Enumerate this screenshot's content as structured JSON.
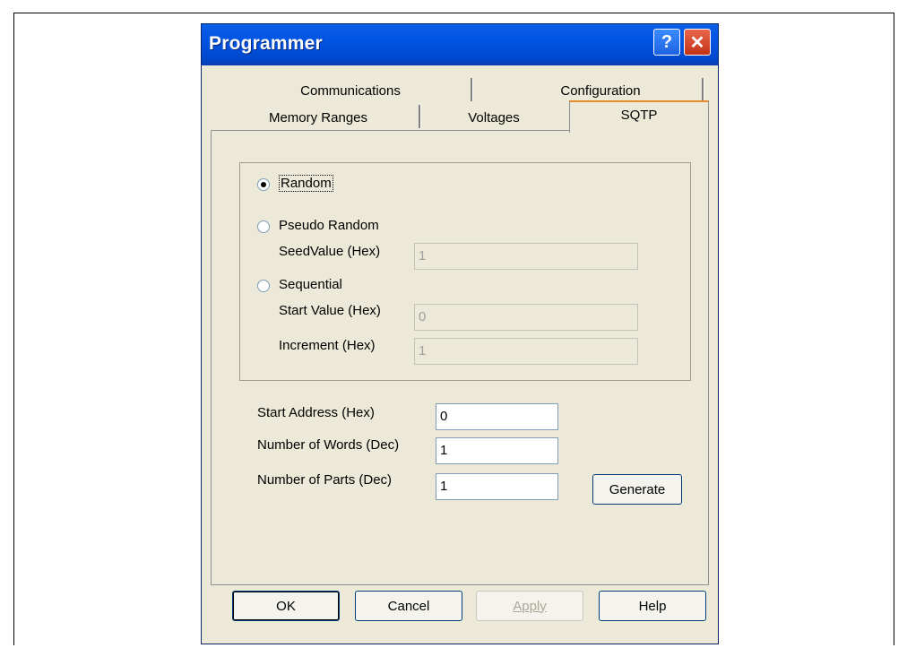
{
  "dialog": {
    "title": "Programmer"
  },
  "titlebar": {
    "help_glyph": "?",
    "close_glyph": "✕"
  },
  "tabs": {
    "row1": [
      "Communications",
      "Configuration"
    ],
    "row2": [
      "Memory Ranges",
      "Voltages",
      "SQTP"
    ],
    "active": "SQTP"
  },
  "sqtp": {
    "random_label": "Random",
    "pseudo_random_label": "Pseudo Random",
    "seed_label": "SeedValue (Hex)",
    "seed_value": "1",
    "sequential_label": "Sequential",
    "start_value_label": "Start Value (Hex)",
    "start_value": "0",
    "increment_label": "Increment (Hex)",
    "increment_value": "1",
    "selected": "Random"
  },
  "fields": {
    "start_address_label": "Start Address (Hex)",
    "start_address_value": "0",
    "num_words_label": "Number of Words (Dec)",
    "num_words_value": "1",
    "num_parts_label": "Number of Parts (Dec)",
    "num_parts_value": "1"
  },
  "buttons": {
    "generate": "Generate",
    "ok": "OK",
    "cancel": "Cancel",
    "apply": "Apply",
    "help": "Help"
  },
  "colors": {
    "titlebar": "#0054e3",
    "dialog_bg": "#ece9d8",
    "close_btn": "#c43215"
  }
}
